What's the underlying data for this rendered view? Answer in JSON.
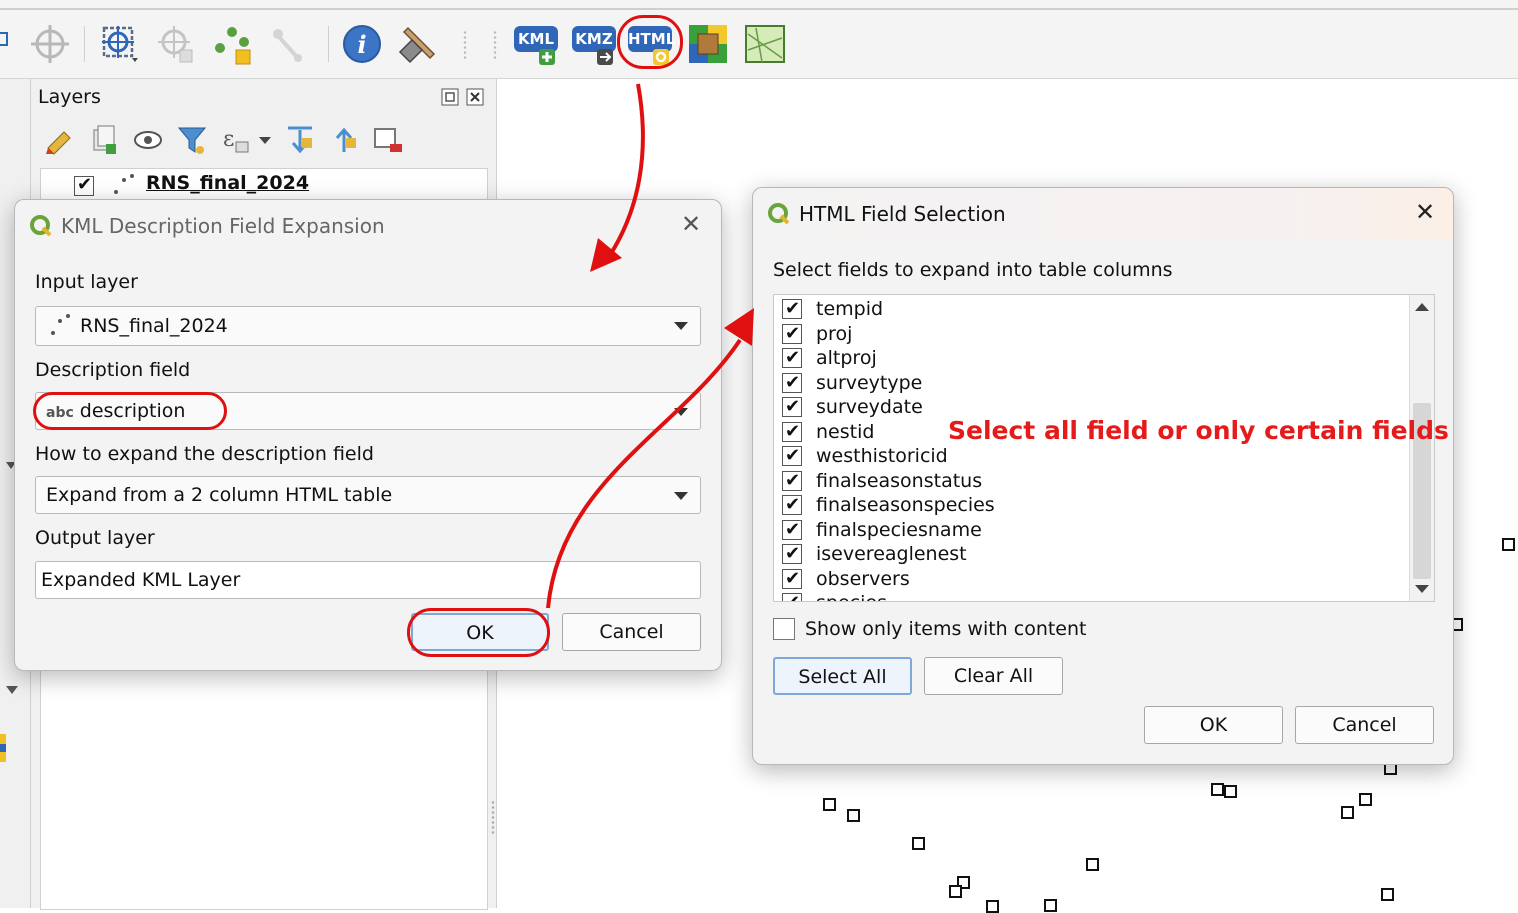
{
  "toolbar": {
    "kml_label": "KML",
    "kmz_label": "KMZ",
    "html_label": "HTML",
    "colors": {
      "kml": "#2f66b8",
      "kmz": "#2f66b8",
      "html": "#2f66b8"
    }
  },
  "layers_panel": {
    "title": "Layers",
    "layer_name": "RNS_final_2024"
  },
  "kml_dialog": {
    "title": "KML Description Field Expansion",
    "input_layer_label": "Input layer",
    "input_layer_value": "RNS_final_2024",
    "description_field_label": "Description field",
    "description_field_type": "abc",
    "description_field_value": "description",
    "expand_label": "How to expand the description field",
    "expand_value": "Expand from a 2 column HTML table",
    "output_layer_label": "Output layer",
    "output_layer_value": "Expanded KML Layer",
    "ok_label": "OK",
    "cancel_label": "Cancel"
  },
  "html_dialog": {
    "title": "HTML Field Selection",
    "instruction": "Select fields to expand into table columns",
    "fields": [
      {
        "name": "tempid",
        "checked": true
      },
      {
        "name": "proj",
        "checked": true
      },
      {
        "name": "altproj",
        "checked": true
      },
      {
        "name": "surveytype",
        "checked": true
      },
      {
        "name": "surveydate",
        "checked": true
      },
      {
        "name": "nestid",
        "checked": true
      },
      {
        "name": "westhistoricid",
        "checked": true
      },
      {
        "name": "finalseasonstatus",
        "checked": true
      },
      {
        "name": "finalseasonspecies",
        "checked": true
      },
      {
        "name": "finalspeciesname",
        "checked": true
      },
      {
        "name": "isevereaglenest",
        "checked": true
      },
      {
        "name": "observers",
        "checked": true
      },
      {
        "name": "species",
        "checked": true
      }
    ],
    "show_only_label": "Show only items with content",
    "show_only_checked": false,
    "select_all_label": "Select All",
    "clear_all_label": "Clear All",
    "ok_label": "OK",
    "cancel_label": "Cancel"
  },
  "annotation": {
    "text": "Select all field or only certain fields",
    "color": "#e51b1b"
  }
}
